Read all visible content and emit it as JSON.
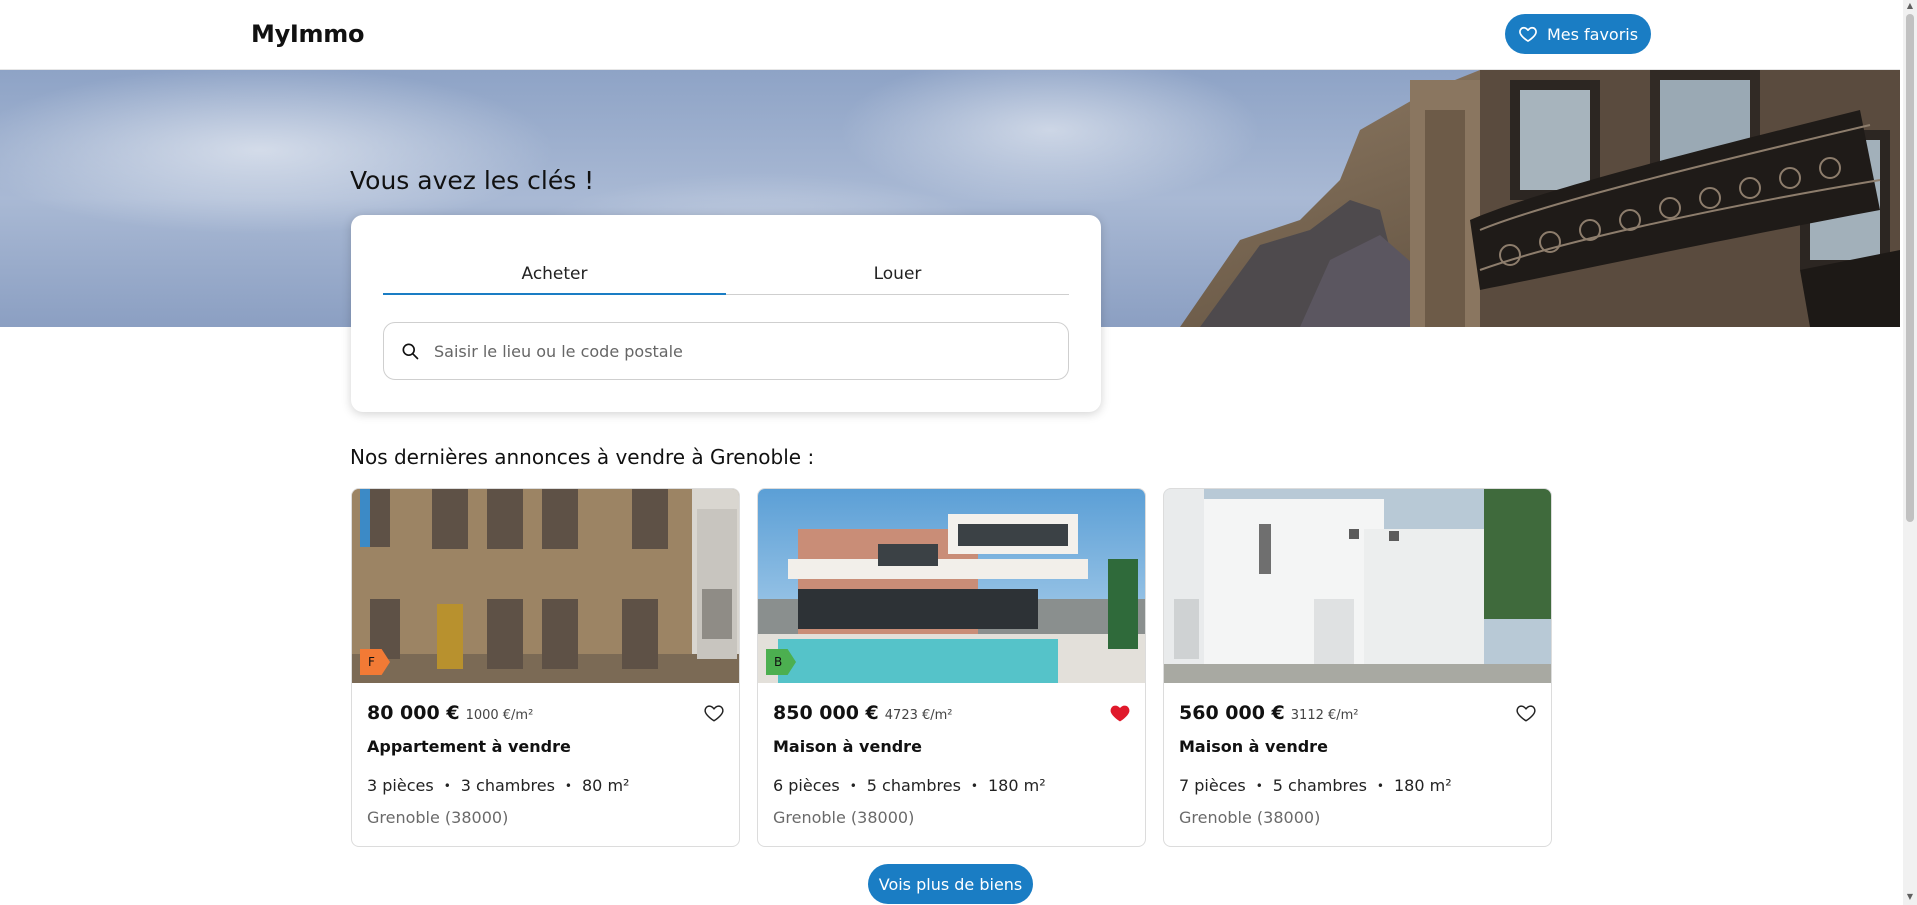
{
  "header": {
    "brand": "MyImmo",
    "favorites_label": "Mes favoris",
    "favorites_icon": "heart-outline-icon"
  },
  "hero": {
    "title": "Vous avez les clés !",
    "tabs": [
      {
        "label": "Acheter",
        "active": true
      },
      {
        "label": "Louer",
        "active": false
      }
    ],
    "search": {
      "placeholder": "Saisir le lieu ou le code postale",
      "value": "",
      "icon": "search-icon"
    }
  },
  "listings": {
    "title": "Nos dernières annonces à vendre à Grenoble :",
    "cards": [
      {
        "price": "80 000 €",
        "price_per_m2": "1000 €/m²",
        "type": "Appartement à vendre",
        "rooms": "3 pièces",
        "bedrooms": "3 chambres",
        "surface": "80 m²",
        "location": "Grenoble (38000)",
        "energy_class": "F",
        "favorite": false,
        "image": "old-apartment-building-facade"
      },
      {
        "price": "850 000 €",
        "price_per_m2": "4723 €/m²",
        "type": "Maison à vendre",
        "rooms": "6 pièces",
        "bedrooms": "5 chambres",
        "surface": "180 m²",
        "location": "Grenoble (38000)",
        "energy_class": "B",
        "favorite": true,
        "image": "modern-villa-with-pool"
      },
      {
        "price": "560 000 €",
        "price_per_m2": "3112 €/m²",
        "type": "Maison à vendre",
        "rooms": "7 pièces",
        "bedrooms": "5 chambres",
        "surface": "180 m²",
        "location": "Grenoble (38000)",
        "energy_class": "",
        "favorite": false,
        "image": "white-modern-house"
      }
    ],
    "separator": "•",
    "more_label": "Vois plus de biens"
  },
  "colors": {
    "accent": "#1a7dc4",
    "favorite_active": "#e0192b",
    "energy_F": "#f27a35",
    "energy_B": "#4caf50"
  }
}
